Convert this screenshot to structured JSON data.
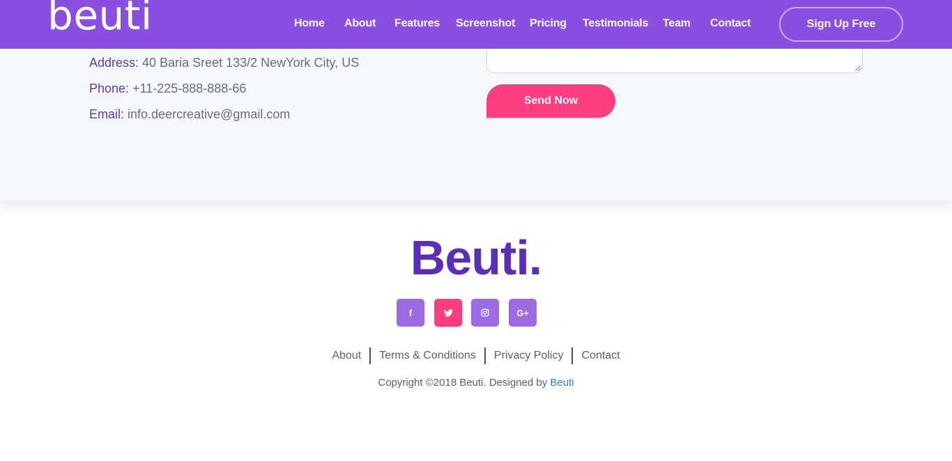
{
  "header": {
    "logo": "beuti",
    "nav": [
      {
        "label": "Home"
      },
      {
        "label": "About"
      },
      {
        "label": "Features"
      },
      {
        "label": "Screenshot"
      },
      {
        "label": "Pricing"
      },
      {
        "label": "Testimonials"
      },
      {
        "label": "Team"
      },
      {
        "label": "Contact"
      }
    ],
    "signup_label": "Sign Up Free"
  },
  "contact": {
    "address_label": "Address:",
    "address_value": " 40 Baria Sreet 133/2 NewYork City, US",
    "phone_label": "Phone:",
    "phone_value": " +11-225-888-888-66",
    "email_label": "Email:",
    "email_value": " info.deercreative@gmail.com",
    "message_value": "",
    "send_label": "Send Now"
  },
  "footer": {
    "brand": "Beuti.",
    "social": [
      {
        "icon": "facebook-icon",
        "glyph": "f",
        "color": "#9c6be3"
      },
      {
        "icon": "twitter-icon",
        "glyph": "🐦",
        "color": "#ff3d7f"
      },
      {
        "icon": "instagram-icon",
        "glyph": "◎",
        "color": "#9c6be3"
      },
      {
        "icon": "google-plus-icon",
        "glyph": "G+",
        "color": "#9c6be3"
      }
    ],
    "links": [
      {
        "label": "About"
      },
      {
        "label": "Terms & Conditions"
      },
      {
        "label": "Privacy Policy"
      },
      {
        "label": "Contact"
      }
    ],
    "copyright_prefix": "Copyright ©2018 Beuti. Designed by ",
    "copyright_link": "Beuti"
  },
  "colors": {
    "nav_bg": "#8a4ee0",
    "accent_pink": "#ff3d7f",
    "brand_purple": "#5b2fb5",
    "link_blue": "#3478d4"
  }
}
